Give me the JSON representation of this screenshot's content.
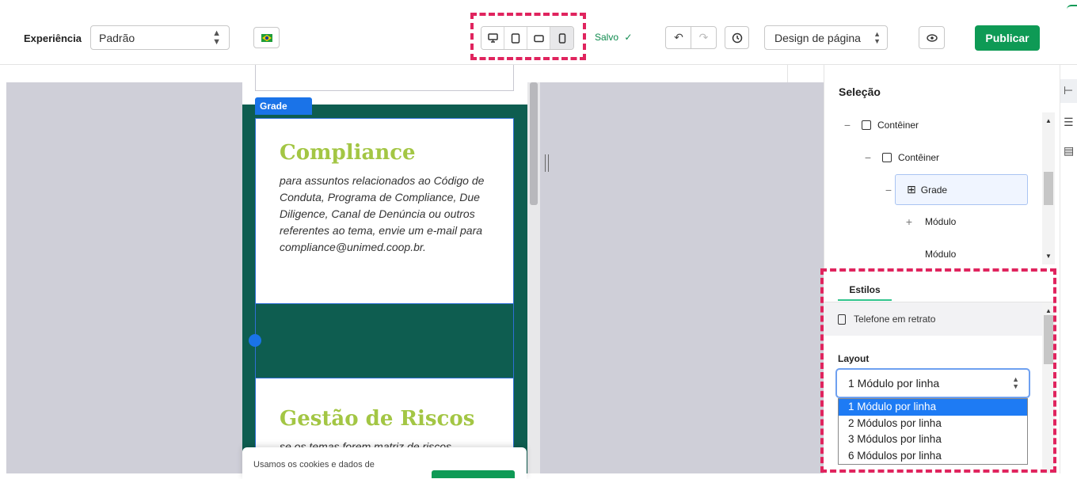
{
  "toolbar": {
    "experience_label": "Experiência",
    "experience_value": "Padrão",
    "flag_icon": "brazil-flag-icon",
    "devices": [
      "desktop",
      "tablet-landscape",
      "tablet-portrait",
      "phone-portrait"
    ],
    "active_device": "phone-portrait",
    "saved_label": "Salvo",
    "page_design_label": "Design de página",
    "publish_label": "Publicar"
  },
  "canvas": {
    "grid_tag": "Grade",
    "cards": [
      {
        "title": "Compliance",
        "body": "para assuntos relacionados ao Código de Conduta, Programa de Compliance, Due Diligence, Canal de Denúncia ou outros referentes ao tema, envie um e-mail para compliance@unimed.coop.br."
      },
      {
        "title": "Gestão de Riscos",
        "body": "se os temas forem matriz de riscos"
      }
    ],
    "cookie_text": "Usamos os cookies e dados de"
  },
  "panel": {
    "title": "Seleção",
    "tree": [
      {
        "toggle": "−",
        "label": "Contêiner",
        "icon": "checkbox-icon"
      },
      {
        "toggle": "−",
        "label": "Contêiner",
        "icon": "checkbox-icon"
      },
      {
        "toggle": "−",
        "label": "Grade",
        "icon": "grid-icon",
        "selected": true
      },
      {
        "toggle": "+",
        "label": "Módulo"
      },
      {
        "toggle": "",
        "label": "Módulo"
      }
    ],
    "styles_tab": "Estilos",
    "device_row_label": "Telefone em retrato",
    "layout_label": "Layout",
    "layout_value": "1 Módulo por linha",
    "layout_options": [
      "1 Módulo por linha",
      "2 Módulos por linha",
      "3 Módulos por linha",
      "6 Módulos por linha"
    ],
    "layout_selected_index": 0
  },
  "colors": {
    "accent_red": "#e0245e",
    "publish_green": "#0e9a55",
    "grid_bg": "#0e5d50",
    "title_green": "#a3c644",
    "selection_blue": "#1a73e8"
  }
}
